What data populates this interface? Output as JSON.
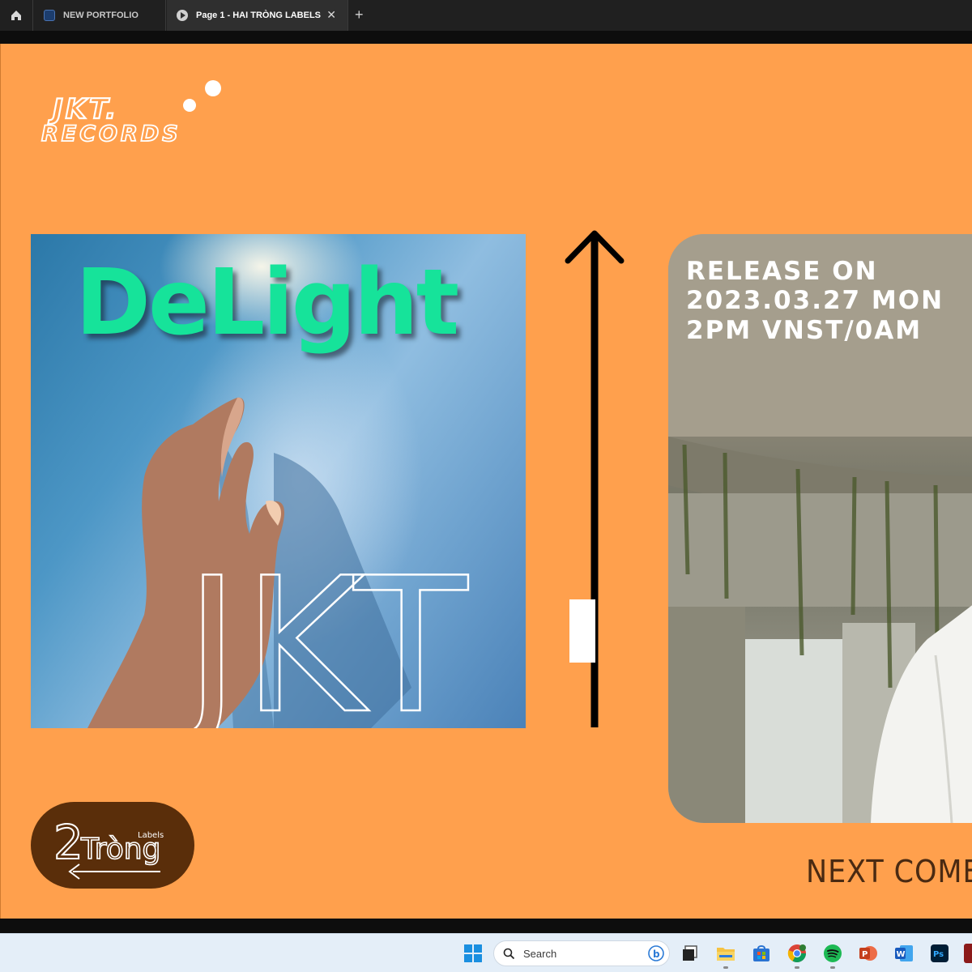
{
  "browser": {
    "tabs": [
      {
        "label": "NEW PORTFOLIO",
        "active": false
      },
      {
        "label": "Page 1 - HAI TRÒNG LABELS",
        "active": true
      }
    ],
    "close_glyph": "✕",
    "new_tab_glyph": "+",
    "home_icon": "home-icon"
  },
  "slide": {
    "background_color": "#ffa04d",
    "logo_top": {
      "line1": "JKT.",
      "line2": "RECORDS"
    },
    "album": {
      "title": "DeLight",
      "artist": "JKT",
      "title_color": "#16e39a"
    },
    "release": {
      "lines": [
        "RELEASE ON",
        "2023.03.27 MON",
        "2PM VNST/0AM"
      ]
    },
    "next_coming": "NEXT COME",
    "logo_bottom": {
      "number": "2",
      "name": "Tròng",
      "tag": "Labels",
      "background_color": "#5a2e0a"
    }
  },
  "taskbar": {
    "search_placeholder": "Search",
    "apps": [
      "windows-start",
      "search",
      "task-view",
      "file-explorer",
      "microsoft-store",
      "chrome",
      "spotify",
      "powerpoint",
      "word",
      "photoshop"
    ]
  }
}
